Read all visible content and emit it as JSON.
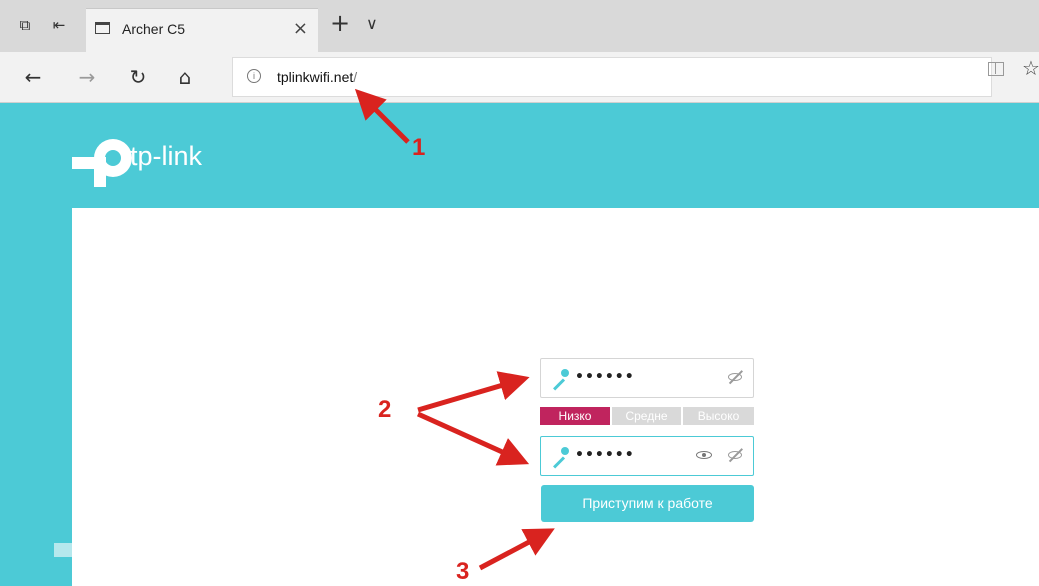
{
  "browser": {
    "tab_title": "Archer C5",
    "close_glyph": "×",
    "new_tab_glyph": "+",
    "tab_list_glyph": "∨",
    "url_host": "tplinkwifi.net",
    "url_path": "/",
    "info_glyph": "i",
    "nav": {
      "back": "←",
      "forward": "→",
      "refresh": "↻",
      "home": "⌂"
    },
    "fav_glyph": "☆",
    "icons": [
      "tab-set-aside-icon",
      "tab-restore-icon",
      "page-icon",
      "info-icon",
      "reader-view-icon",
      "favorite-star-icon"
    ]
  },
  "page": {
    "logo_text": "tp-link",
    "password_mask": "••••••",
    "confirm_mask": "••••••",
    "strength": {
      "low": "Низко",
      "medium": "Средне",
      "high": "Высоко",
      "level": "low"
    },
    "submit_label": "Приступим к работе",
    "colors": {
      "accent": "#4ccad6",
      "strength_low": "#c0245e",
      "annotation": "#d9231f"
    }
  },
  "annotations": {
    "one": "1",
    "two": "2",
    "three": "3"
  }
}
